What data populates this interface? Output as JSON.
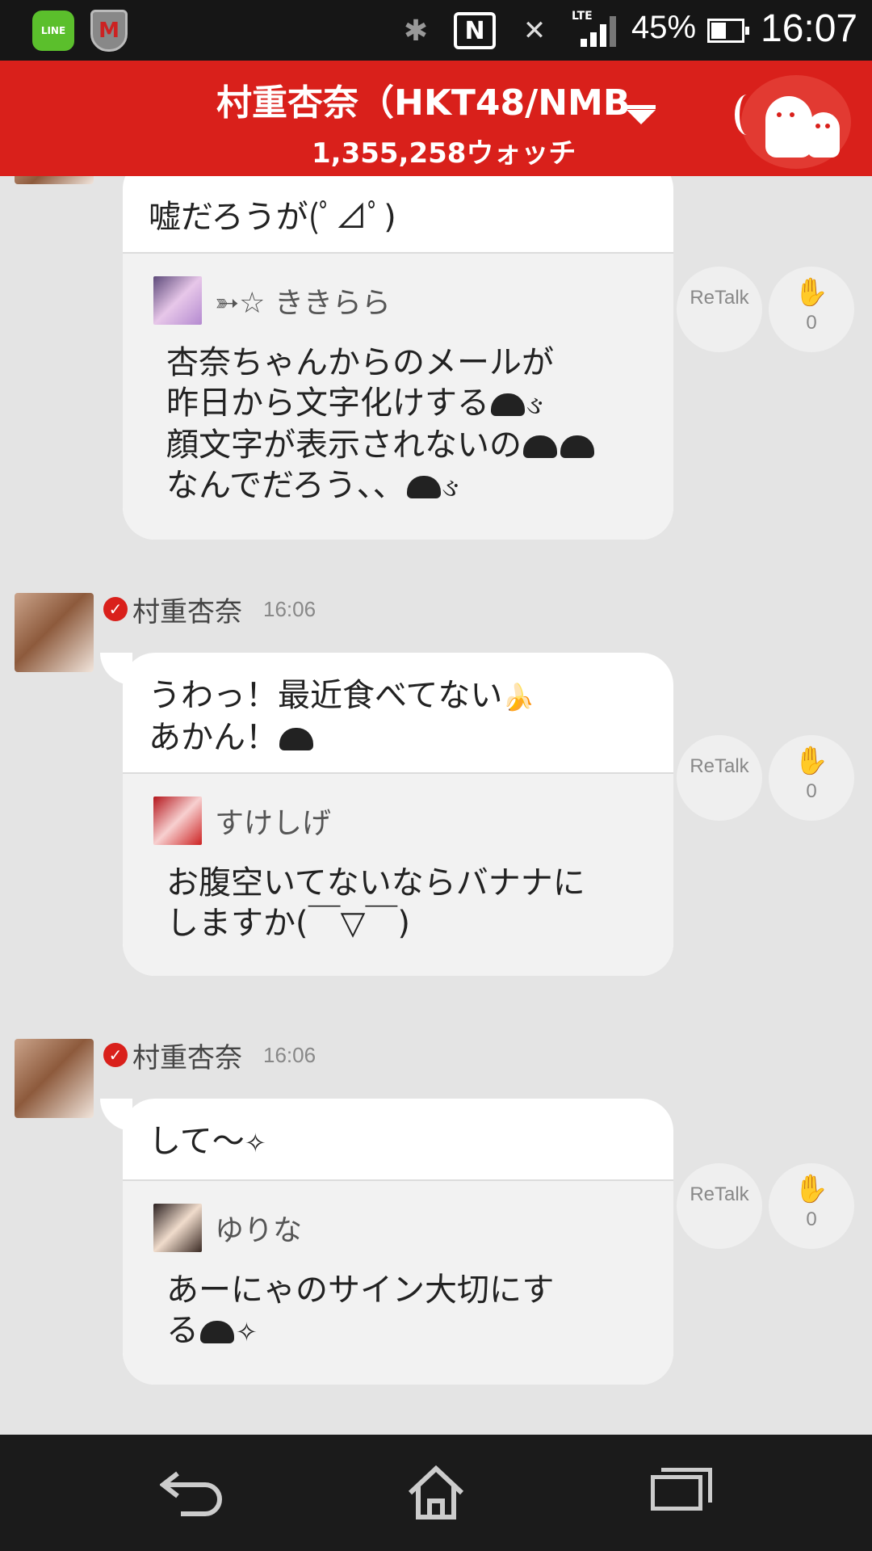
{
  "status_bar": {
    "line_app_label": "LINE",
    "mcafee_label": "M",
    "network_type": "LTE",
    "battery_percent": "45%",
    "battery_level": 0.45,
    "clock": "16:07"
  },
  "header": {
    "title": "村重杏奈（HKT48/NMB",
    "watch_count": "1,355,258ウォッチ"
  },
  "posts": [
    {
      "main_text": "嘘だろうが(ﾟ⊿ﾟ)",
      "quote": {
        "name": "➳☆ ききらら",
        "text_lines": [
          "杏奈ちゃんからのメールが",
          "昨日から文字化けする",
          "顔文字が表示されないの",
          "なんでだろう、、"
        ]
      },
      "retalk_label": "ReTalk",
      "clap_count": "0"
    },
    {
      "author": "村重杏奈",
      "time": "16:06",
      "main_text_lines": [
        "うわっ！最近食べてない",
        "あかん！"
      ],
      "quote": {
        "name": "すけしげ",
        "text_lines": [
          "お腹空いてないならバナナに",
          "しますか(￣▽￣)"
        ]
      },
      "retalk_label": "ReTalk",
      "clap_count": "0"
    },
    {
      "author": "村重杏奈",
      "time": "16:06",
      "main_text": "して〜",
      "quote": {
        "name": "ゆりな",
        "text_lines": [
          "あーにゃのサイン大切にす",
          "る"
        ]
      },
      "retalk_label": "ReTalk",
      "clap_count": "0"
    }
  ],
  "icons": {
    "retalk": "retalk-icon",
    "clap": "clap-icon",
    "verified": "verified-icon",
    "back": "back-icon",
    "home": "home-icon",
    "recent": "recent-apps-icon"
  },
  "colors": {
    "brand_red": "#d9201b",
    "feed_bg": "#e4e4e4",
    "status_bar_bg": "#161616",
    "nav_bar_bg": "#1b1b1b"
  }
}
